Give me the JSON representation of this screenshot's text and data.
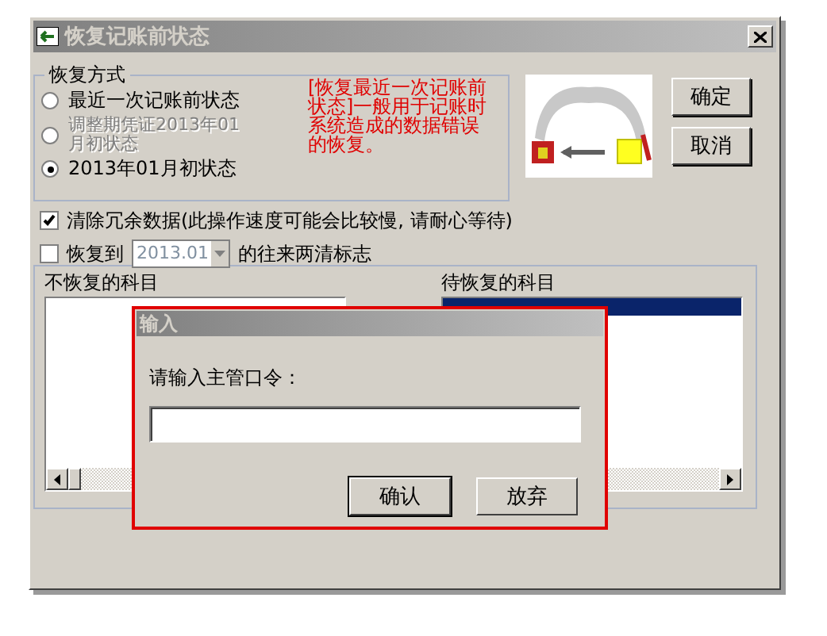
{
  "window": {
    "title": "恢复记账前状态"
  },
  "restore_mode": {
    "label": "恢复方式",
    "options": [
      {
        "label": "最近一次记账前状态",
        "selected": false,
        "disabled": false
      },
      {
        "label": "调整期凭证2013年01月初状态",
        "selected": false,
        "disabled": true
      },
      {
        "label": "2013年01月初状态",
        "selected": true,
        "disabled": false
      }
    ]
  },
  "note": "[恢复最近一次记账前状态]一般用于记账时系统造成的数据错误的恢复。",
  "buttons": [
    {
      "label": "确定"
    },
    {
      "label": "取消"
    }
  ],
  "options": [
    {
      "kind": "checkbox",
      "label": "清除冗余数据(此操作速度可能会比较慢, 请耐心等待)",
      "checked": true
    },
    {
      "kind": "period",
      "label": "恢复到",
      "value": "2013.01",
      "label_after": "的往来两清标志",
      "checked": false
    }
  ],
  "lists": [
    {
      "label": "不恢复的科目"
    },
    {
      "label": "待恢复的科目",
      "rows": [
        {
          "selected": true
        }
      ]
    }
  ],
  "dialog": {
    "title": "输入",
    "prompt": "请输入主管口令：",
    "buttons": [
      {
        "label": "确认",
        "default": true
      },
      {
        "label": "放弃",
        "default": false
      }
    ]
  }
}
